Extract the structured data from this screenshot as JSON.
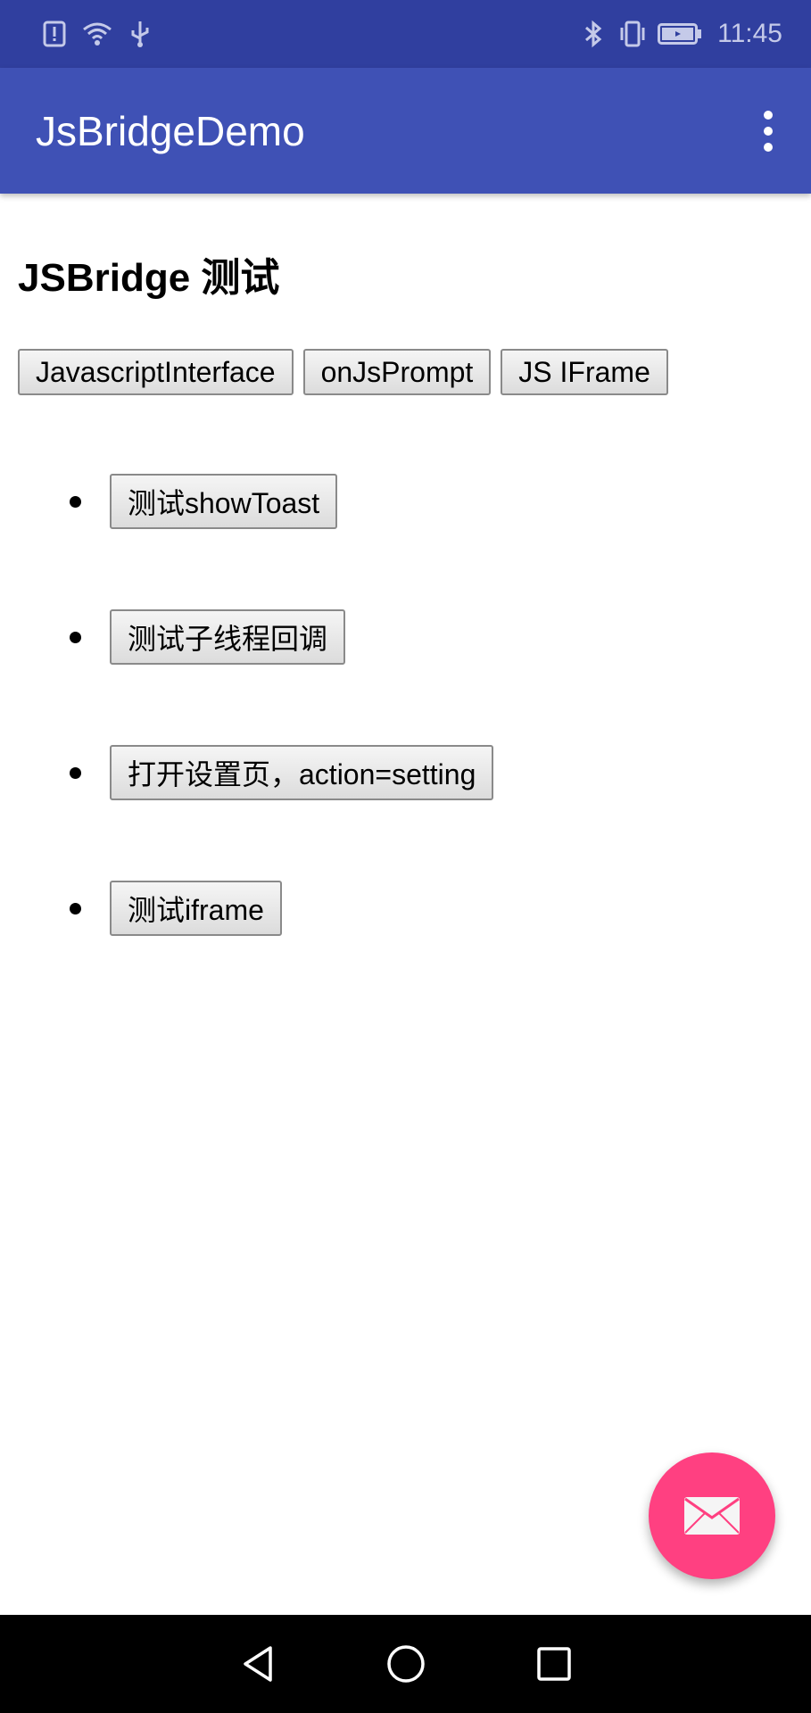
{
  "status_bar": {
    "time": "11:45",
    "left_icons": [
      "alert-icon",
      "wifi-icon",
      "usb-icon"
    ],
    "right_icons": [
      "bluetooth-icon",
      "vibrate-icon",
      "battery-icon"
    ],
    "background": "#303f9f"
  },
  "app_bar": {
    "title": "JsBridgeDemo",
    "overflow_icon": "more-vert-icon",
    "background": "#3f51b5"
  },
  "main": {
    "heading": "JSBridge 测试",
    "mode_buttons": [
      {
        "label": "JavascriptInterface"
      },
      {
        "label": "onJsPrompt"
      },
      {
        "label": "JS IFrame"
      }
    ],
    "test_items": [
      {
        "label": "测试showToast"
      },
      {
        "label": "测试子线程回调"
      },
      {
        "label": "打开设置页，action=setting"
      },
      {
        "label": "测试iframe"
      }
    ]
  },
  "fab": {
    "icon": "mail-icon",
    "color": "#ff4081"
  },
  "nav_bar": {
    "buttons": [
      "back-icon",
      "home-icon",
      "recents-icon"
    ]
  }
}
